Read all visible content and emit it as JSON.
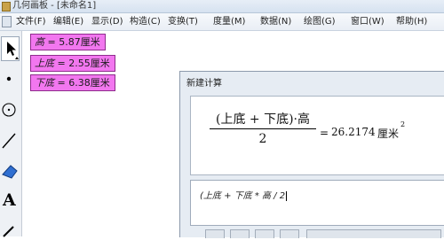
{
  "window": {
    "title": "几何画板 - [未命名1]"
  },
  "menubar": {
    "items": [
      {
        "label": "文件(F)"
      },
      {
        "label": "编辑(E)"
      },
      {
        "label": "显示(D)"
      },
      {
        "label": "构造(C)"
      },
      {
        "label": "变换(T)"
      },
      {
        "label": "度量(M)"
      },
      {
        "label": "数据(N)"
      },
      {
        "label": "绘图(G)"
      },
      {
        "label": "窗口(W)"
      },
      {
        "label": "帮助(H)"
      }
    ]
  },
  "toolbox": {
    "tools": [
      "arrow-select-icon",
      "point-tool-icon",
      "compass-tool-icon",
      "straightedge-tool-icon",
      "polygon-tool-icon",
      "text-tool-icon",
      "marker-tool-icon"
    ],
    "text_tool_label": "A",
    "selected": "arrow-select-icon"
  },
  "measurements": [
    {
      "name": "高",
      "value": "5.87厘米"
    },
    {
      "name": "上底",
      "value": "2.55厘米"
    },
    {
      "name": "下底",
      "value": "6.38厘米"
    }
  ],
  "measure_equals": " = ",
  "dialog": {
    "title": "新建计算",
    "preview": {
      "numerator": "(上底 + 下底)·高",
      "denominator": "2",
      "equals": "=",
      "result": "26.2174",
      "unit": "厘米",
      "unit_power": "2"
    },
    "input_text": "(上底 + 下底 * 高 / 2"
  },
  "colors": {
    "measurement_fill": "#f277ef",
    "measurement_border": "#8e2c8c",
    "dialog_bg": "#e6ecf3"
  }
}
